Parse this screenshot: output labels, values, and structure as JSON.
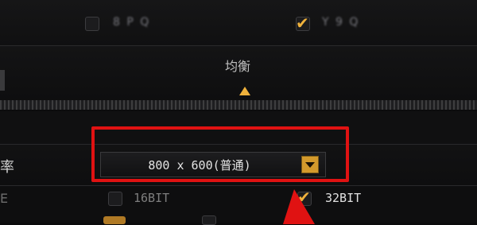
{
  "graphics_options": {
    "balance_label": "均衡",
    "resolution": {
      "row_label": "率",
      "selected_value": "800 x 600(普通)"
    },
    "color_depth": {
      "row_label": "E",
      "option_16": "16BIT",
      "option_32": "32BIT",
      "selected": "32BIT"
    },
    "top_options": {
      "option_1_label": "8 P Q",
      "option_2_label": "Y 9 Q"
    }
  },
  "annotation": {
    "highlight_color": "#e01212"
  },
  "colors": {
    "accent": "#f0b23c",
    "background": "#0b0b0c"
  }
}
